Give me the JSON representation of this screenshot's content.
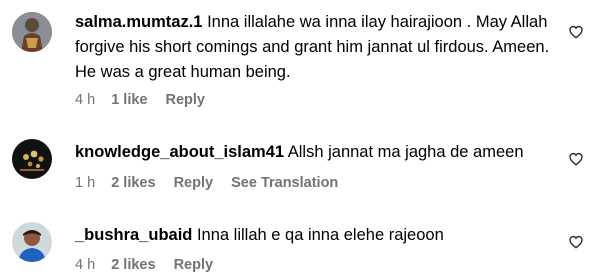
{
  "comments": [
    {
      "username": "salma.mumtaz.1",
      "text": "Inna illalahe wa inna ilay hairajioon . May Allah forgive his short comings and grant him jannat ul firdous. Ameen. He was a great human being.",
      "time": "4 h",
      "likes": "1 like",
      "reply": "Reply",
      "avatar_icon": "profile-avatar-image",
      "like_icon": "heart-outline-icon"
    },
    {
      "username": "knowledge_about_islam41",
      "text": "Allsh jannat ma jagha de ameen",
      "time": "1 h",
      "likes": "2 likes",
      "reply": "Reply",
      "translation": "See Translation",
      "avatar_icon": "profile-avatar-image",
      "like_icon": "heart-outline-icon"
    },
    {
      "username": "_bushra_ubaid",
      "text": "Inna lillah e qa inna elehe rajeoon",
      "time": "4 h",
      "likes": "2 likes",
      "reply": "Reply",
      "avatar_icon": "profile-avatar-image",
      "like_icon": "heart-outline-icon"
    }
  ],
  "colors": {
    "text": "#000000",
    "meta": "#737373",
    "background": "#ffffff"
  }
}
